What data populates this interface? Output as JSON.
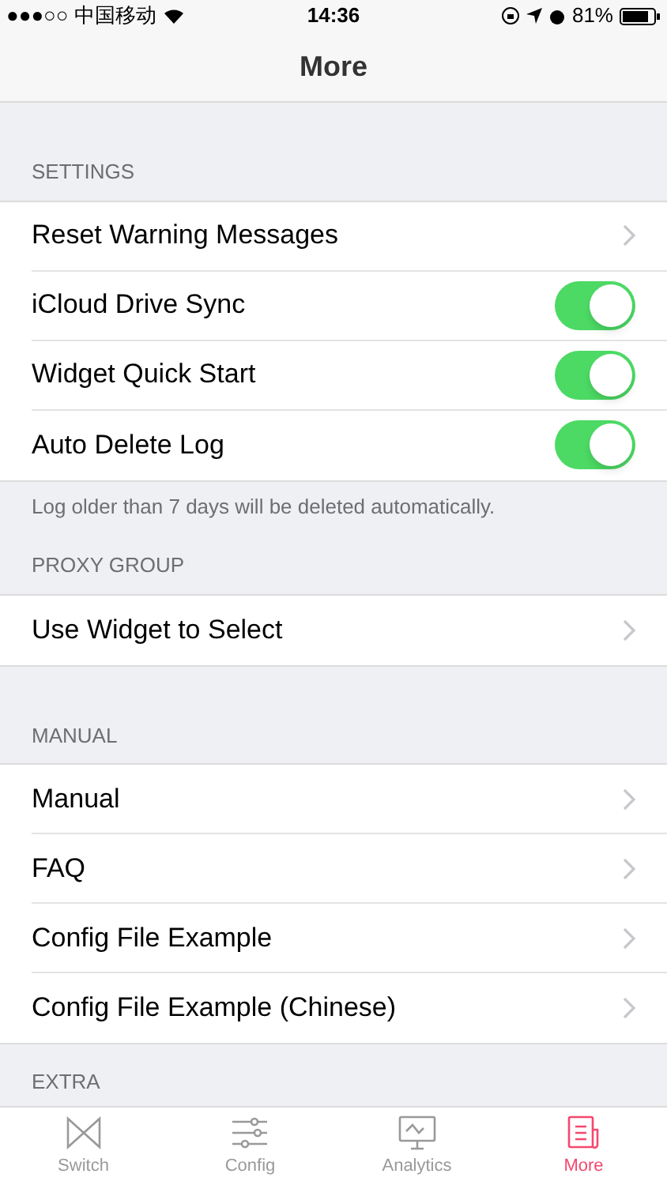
{
  "status_bar": {
    "carrier": "●●●○○ 中国移动",
    "time": "14:36",
    "battery": "81%"
  },
  "nav": {
    "title": "More"
  },
  "sections": [
    {
      "header": "SETTINGS",
      "footer": "Log older than 7 days will be deleted automatically.",
      "rows": [
        {
          "kind": "link",
          "label": "Reset Warning Messages"
        },
        {
          "kind": "toggle",
          "label": "iCloud Drive Sync",
          "on": true
        },
        {
          "kind": "toggle",
          "label": "Widget Quick Start",
          "on": true
        },
        {
          "kind": "toggle",
          "label": "Auto Delete Log",
          "on": true
        }
      ]
    },
    {
      "header": "PROXY GROUP",
      "rows": [
        {
          "kind": "link",
          "label": "Use Widget to Select"
        }
      ]
    },
    {
      "header": "MANUAL",
      "rows": [
        {
          "kind": "link",
          "label": "Manual"
        },
        {
          "kind": "link",
          "label": "FAQ"
        },
        {
          "kind": "link",
          "label": "Config File Example"
        },
        {
          "kind": "link",
          "label": "Config File Example (Chinese)"
        }
      ]
    },
    {
      "header": "EXTRA"
    }
  ],
  "tabs": [
    {
      "label": "Switch",
      "selected": false
    },
    {
      "label": "Config",
      "selected": false
    },
    {
      "label": "Analytics",
      "selected": false
    },
    {
      "label": "More",
      "selected": true
    }
  ]
}
